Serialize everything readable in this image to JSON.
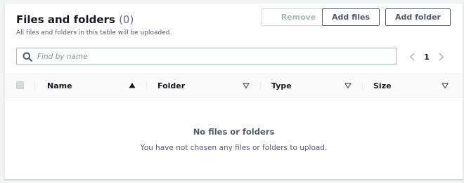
{
  "header": {
    "title": "Files and folders",
    "count": "(0)",
    "description": "All files and folders in this table will be uploaded."
  },
  "actions": {
    "remove_label": "Remove",
    "add_files_label": "Add files",
    "add_folder_label": "Add folder"
  },
  "search": {
    "placeholder": "Find by name",
    "value": ""
  },
  "pagination": {
    "current_page": "1",
    "prev_icon": "chevron-left-icon",
    "next_icon": "chevron-right-icon"
  },
  "table": {
    "columns": [
      {
        "label": "Name",
        "sort": "ascending"
      },
      {
        "label": "Folder",
        "sort": "none"
      },
      {
        "label": "Type",
        "sort": "none"
      },
      {
        "label": "Size",
        "sort": "none"
      }
    ],
    "empty_title": "No files or folders",
    "empty_description": "You have not chosen any files or folders to upload."
  },
  "colors": {
    "text_primary": "#16191f",
    "text_secondary": "#545b64",
    "border": "#aab7b8",
    "disabled": "#aab7b8"
  }
}
